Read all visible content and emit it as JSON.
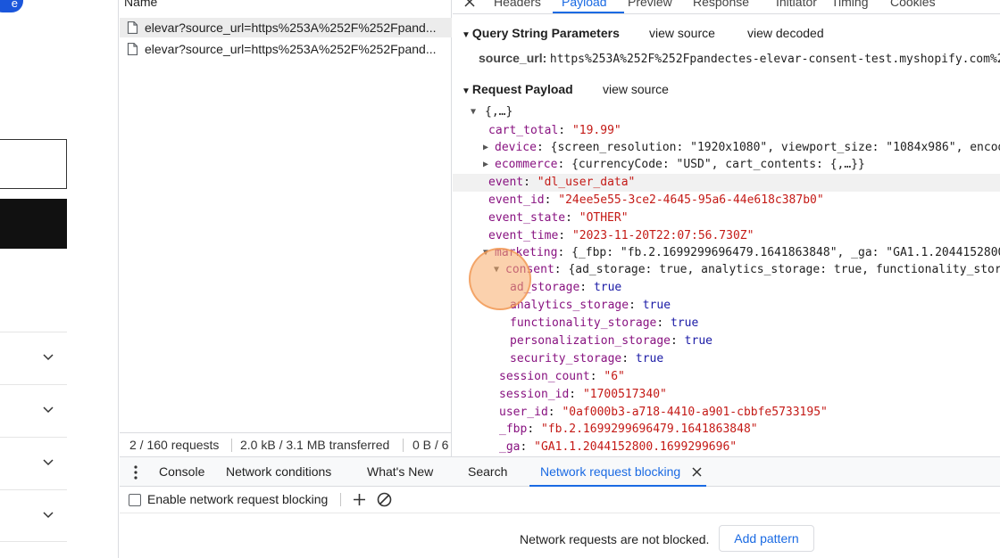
{
  "left_page": {
    "pill_text": "e",
    "accordion_count": 4
  },
  "network": {
    "column_name": "Name",
    "requests": [
      {
        "name": "elevar?source_url=https%253A%252F%252Fpand...",
        "selected": true
      },
      {
        "name": "elevar?source_url=https%253A%252F%252Fpand...",
        "selected": false
      }
    ],
    "footer": {
      "requests": "2 / 160 requests",
      "transferred": "2.0 kB / 3.1 MB transferred",
      "resources": "0 B / 6"
    }
  },
  "detail": {
    "close_icon": "close-icon",
    "tabs": [
      "Headers",
      "Payload",
      "Preview",
      "Response",
      "Initiator",
      "Timing",
      "Cookies"
    ],
    "active_tab": "Payload",
    "query": {
      "title": "Query String Parameters",
      "view_source": "view source",
      "view_decoded": "view decoded",
      "param_key": "source_url:",
      "param_value": "https%253A%252F%252Fpandectes-elevar-consent-test.myshopify.com%2"
    },
    "payload": {
      "title": "Request Payload",
      "view_source": "view source",
      "root": "{,…}",
      "cart_total_key": "cart_total",
      "cart_total_val": "\"19.99\"",
      "device_key": "device",
      "device_val": "{screen_resolution: \"1920x1080\", viewport_size: \"1084x986\", encod",
      "ecommerce_key": "ecommerce",
      "ecommerce_val": "{currencyCode: \"USD\", cart_contents: {,…}}",
      "event_key": "event",
      "event_val": "\"dl_user_data\"",
      "event_id_key": "event_id",
      "event_id_val": "\"24ee5e55-3ce2-4645-95a6-44e618c387b0\"",
      "event_state_key": "event_state",
      "event_state_val": "\"OTHER\"",
      "event_time_key": "event_time",
      "event_time_val": "\"2023-11-20T22:07:56.730Z\"",
      "marketing_key": "marketing",
      "marketing_val": "{_fbp: \"fb.2.1699299696479.1641863848\", _ga: \"GA1.1.2044152800",
      "consent_key": "consent",
      "consent_val": "{ad_storage: true, analytics_storage: true, functionality_stora",
      "ad_storage_key": "ad_storage",
      "ad_storage_val": "true",
      "analytics_storage_key": "analytics_storage",
      "analytics_storage_val": "true",
      "functionality_storage_key": "functionality_storage",
      "functionality_storage_val": "true",
      "personalization_storage_key": "personalization_storage",
      "personalization_storage_val": "true",
      "security_storage_key": "security_storage",
      "security_storage_val": "true",
      "session_count_key": "session_count",
      "session_count_val": "\"6\"",
      "session_id_key": "session_id",
      "session_id_val": "\"1700517340\"",
      "user_id_key": "user_id",
      "user_id_val": "\"0af000b3-a718-4410-a901-cbbfe5733195\"",
      "fbp_key": "_fbp",
      "fbp_val": "\"fb.2.1699299696479.1641863848\"",
      "ga_key": "_ga",
      "ga_val": "\"GA1.1.2044152800.1699299696\""
    }
  },
  "drawer": {
    "tabs": [
      "Console",
      "Network conditions",
      "What's New",
      "Search",
      "Network request blocking"
    ],
    "active_tab": "Network request blocking",
    "enable_label": "Enable network request blocking",
    "status_message": "Network requests are not blocked.",
    "add_pattern": "Add pattern"
  },
  "colors": {
    "accent": "#1a6ae3",
    "key": "#881280",
    "string": "#c41a16",
    "boolean": "#1a1aa6"
  }
}
